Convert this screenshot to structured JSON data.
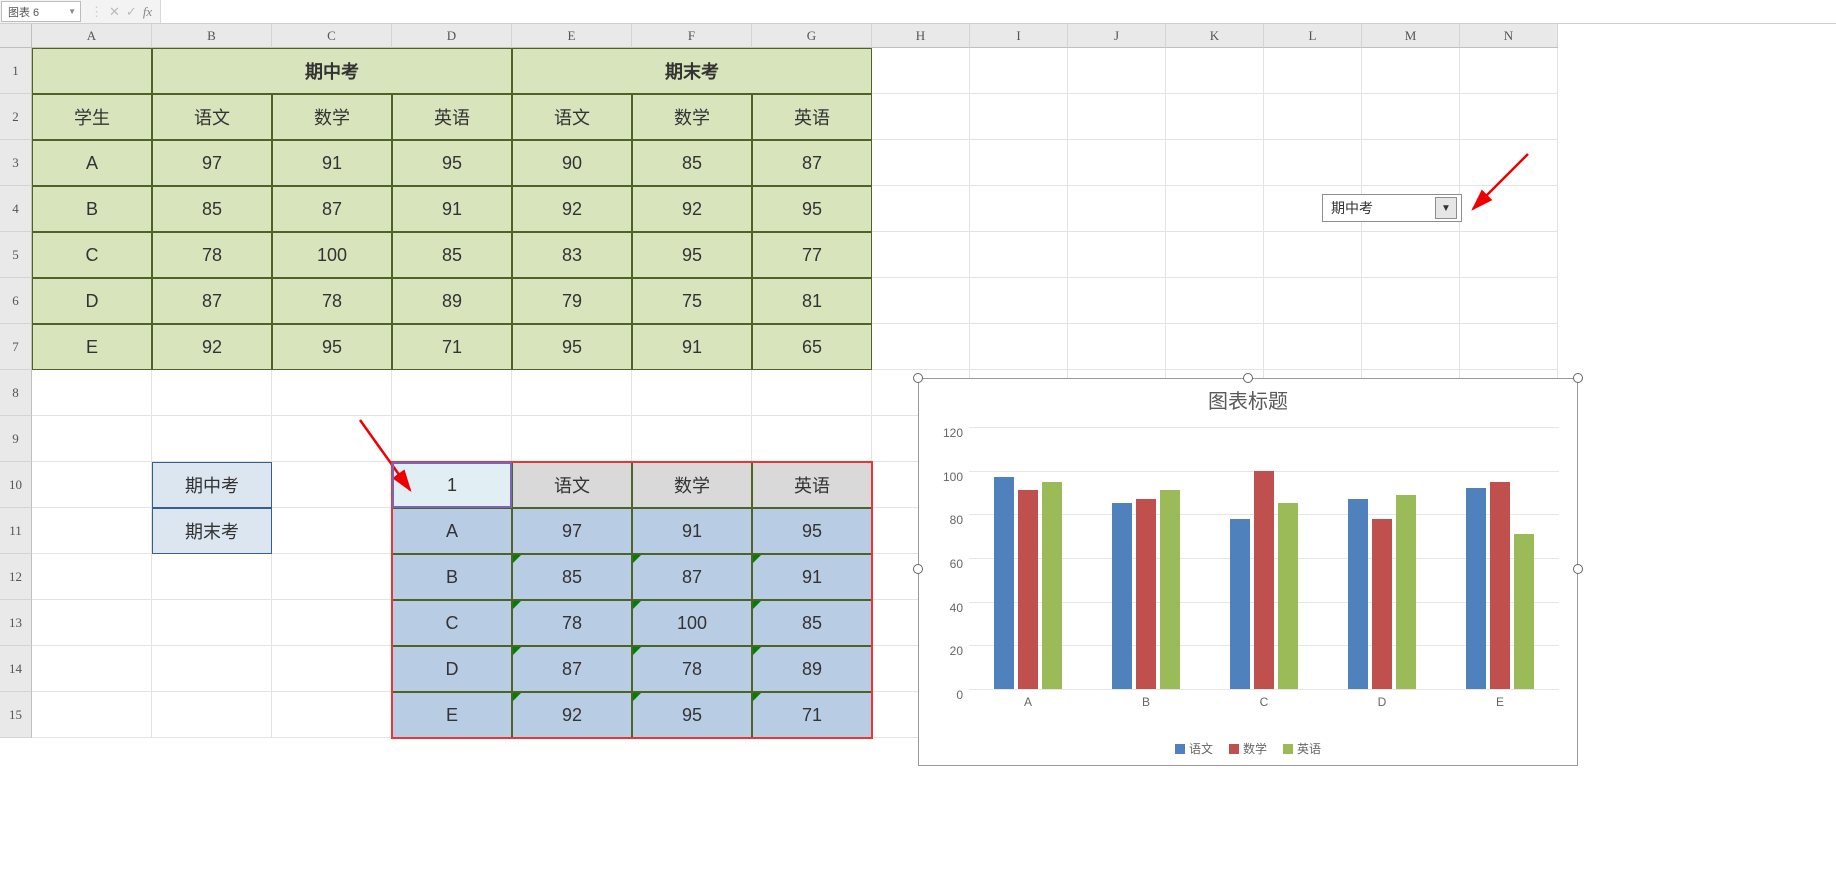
{
  "name_box": "图表 6",
  "fx_label": "fx",
  "columns": [
    "A",
    "B",
    "C",
    "D",
    "E",
    "F",
    "G",
    "H",
    "I",
    "J",
    "K",
    "L",
    "M",
    "N"
  ],
  "row_count": 15,
  "main_table": {
    "merged_headers": [
      {
        "label": "期中考",
        "col_start": 1,
        "col_span": 3
      },
      {
        "label": "期末考",
        "col_start": 4,
        "col_span": 3
      }
    ],
    "sub_headers": [
      "学生",
      "语文",
      "数学",
      "英语",
      "语文",
      "数学",
      "英语"
    ],
    "rows": [
      [
        "A",
        "97",
        "91",
        "95",
        "90",
        "85",
        "87"
      ],
      [
        "B",
        "85",
        "87",
        "91",
        "92",
        "92",
        "95"
      ],
      [
        "C",
        "78",
        "100",
        "85",
        "83",
        "95",
        "77"
      ],
      [
        "D",
        "87",
        "78",
        "89",
        "79",
        "75",
        "81"
      ],
      [
        "E",
        "92",
        "95",
        "71",
        "95",
        "91",
        "65"
      ]
    ]
  },
  "option_list": [
    "期中考",
    "期末考"
  ],
  "result_table": {
    "top_left": "1",
    "headers": [
      "语文",
      "数学",
      "英语"
    ],
    "rows": [
      [
        "A",
        "97",
        "91",
        "95"
      ],
      [
        "B",
        "85",
        "87",
        "91"
      ],
      [
        "C",
        "78",
        "100",
        "85"
      ],
      [
        "D",
        "87",
        "78",
        "89"
      ],
      [
        "E",
        "92",
        "95",
        "71"
      ]
    ]
  },
  "dropdown_value": "期中考",
  "chart": {
    "title": "图表标题",
    "legend": [
      "语文",
      "数学",
      "英语"
    ],
    "colors": [
      "#4f81bd",
      "#c0504d",
      "#9bbb59"
    ]
  },
  "chart_data": {
    "type": "bar",
    "title": "图表标题",
    "categories": [
      "A",
      "B",
      "C",
      "D",
      "E"
    ],
    "series": [
      {
        "name": "语文",
        "values": [
          97,
          85,
          78,
          87,
          92
        ]
      },
      {
        "name": "数学",
        "values": [
          91,
          87,
          100,
          78,
          95
        ]
      },
      {
        "name": "英语",
        "values": [
          95,
          91,
          85,
          89,
          71
        ]
      }
    ],
    "ylim": [
      0,
      120
    ],
    "yticks": [
      0,
      20,
      40,
      60,
      80,
      100,
      120
    ]
  }
}
